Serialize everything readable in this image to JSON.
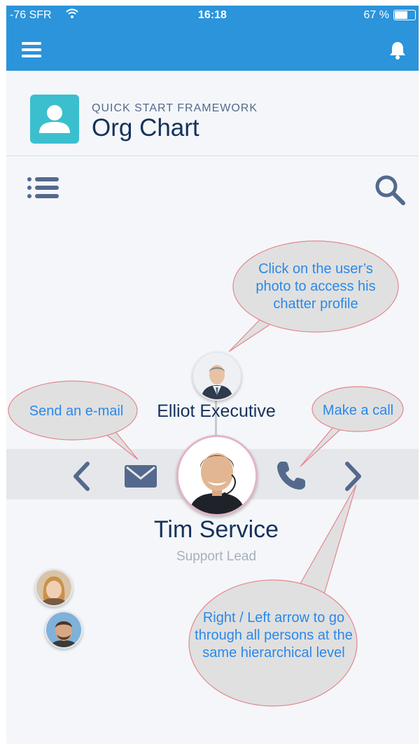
{
  "status_bar": {
    "carrier": "-76 SFR",
    "time": "16:18",
    "battery": "67 %",
    "battery_level": 0.67
  },
  "header": {
    "menu_icon": "hamburger-icon",
    "notifications_icon": "bell-icon"
  },
  "app": {
    "subtitle": "QUICK START FRAMEWORK",
    "title": "Org Chart",
    "icon": "person-icon"
  },
  "toolbar": {
    "list_icon": "list-icon",
    "search_icon": "search-icon"
  },
  "org_chart": {
    "manager": {
      "name": "Elliot Executive"
    },
    "person": {
      "name": "Tim Service",
      "role": "Support Lead"
    },
    "actions": {
      "prev_icon": "chevron-left-icon",
      "email_icon": "envelope-icon",
      "call_icon": "phone-icon",
      "next_icon": "chevron-right-icon"
    },
    "colors": {
      "accent": "#54698d",
      "navy": "#16325c",
      "band": "#e6e7eb"
    }
  },
  "callouts": {
    "photo": "Click on the user’s photo to access his chatter profile",
    "email": "Send an e-mail",
    "call": "Make a call",
    "arrows": "Right / Left arrow to go through all persons at the same hierarchical level",
    "text_color": "#2b88ea",
    "fill_color": "#e0e0e0",
    "stroke_color": "#e6868c"
  }
}
